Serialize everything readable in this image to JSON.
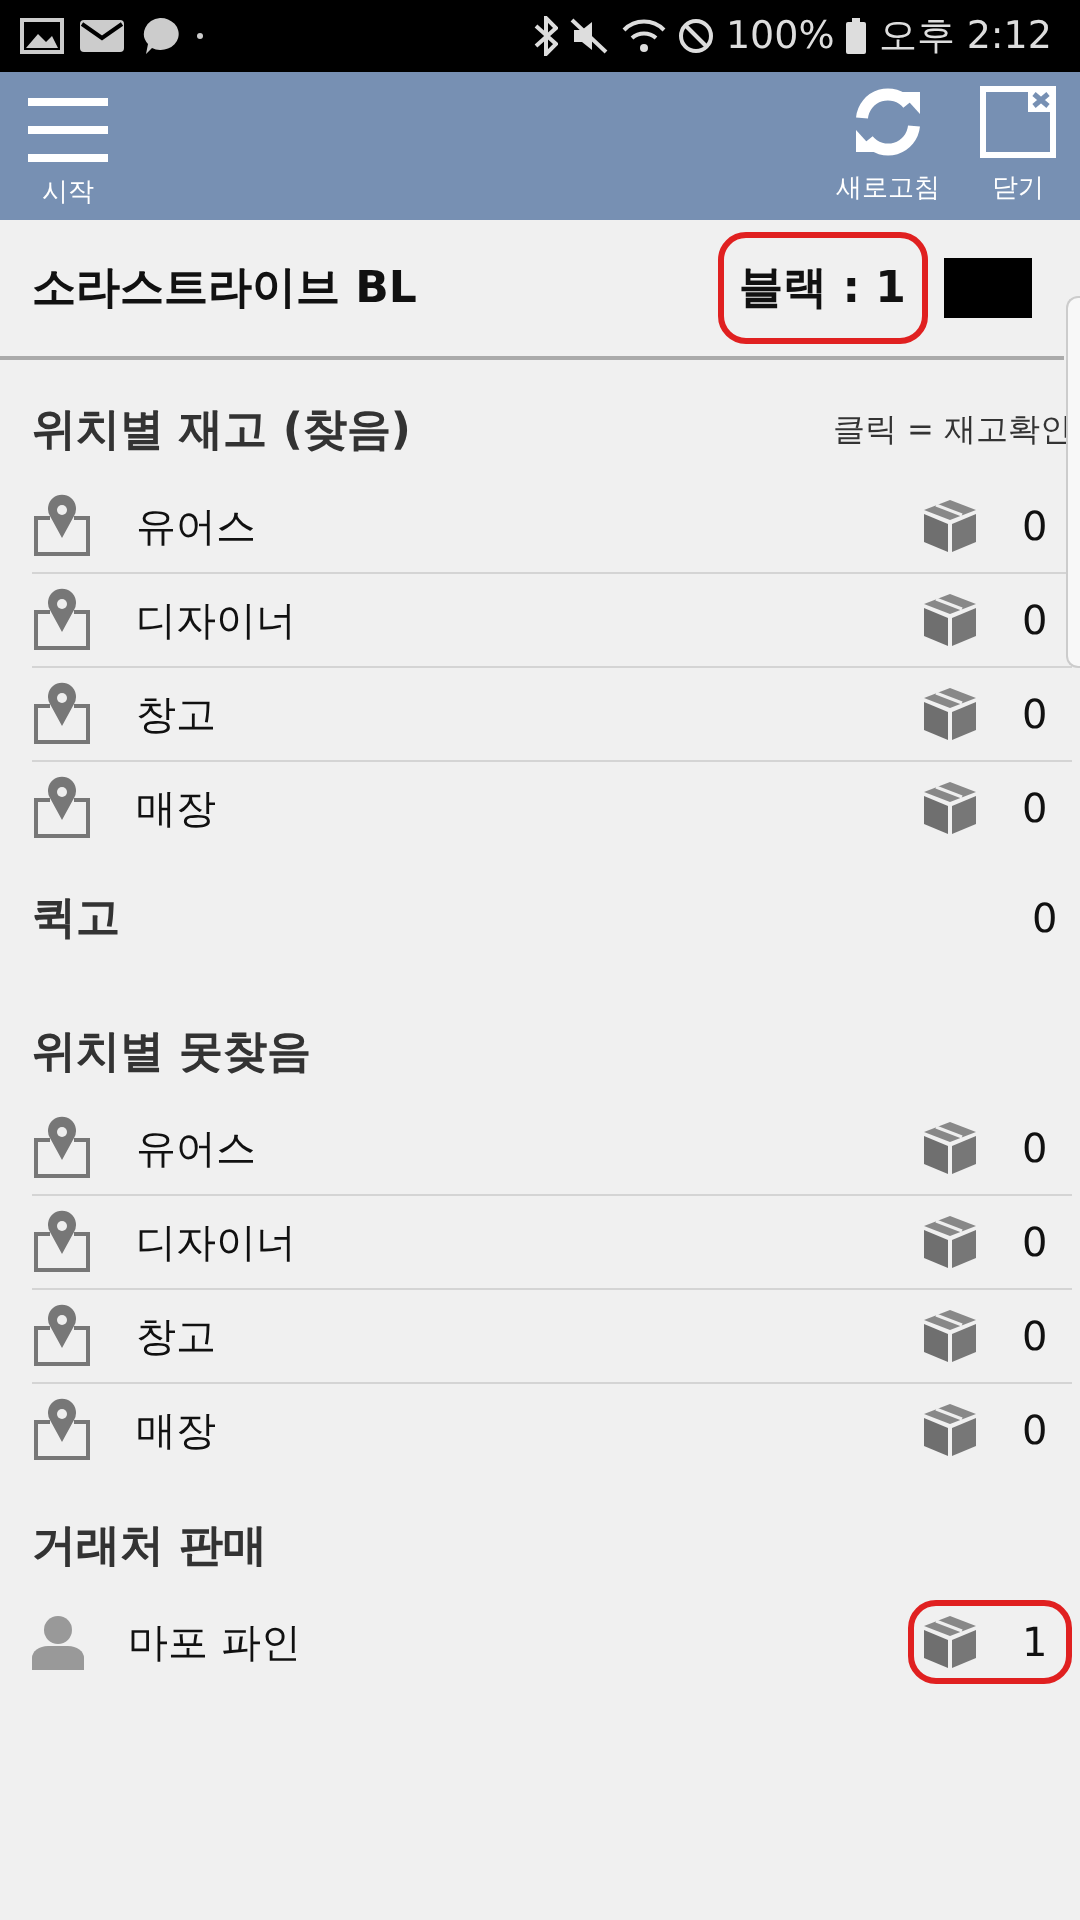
{
  "status_bar": {
    "battery": "100%",
    "time": "오후 2:12"
  },
  "toolbar": {
    "menu_label": "시작",
    "actions": [
      {
        "kind": "refresh",
        "label": "새로고침"
      },
      {
        "kind": "close",
        "label": "닫기"
      }
    ]
  },
  "product": {
    "name": "소라스트라이브 BL",
    "color_label": "블랙 : 1",
    "color": "#000000",
    "highlighted": true
  },
  "sections": [
    {
      "kind": "list",
      "title": "위치별 재고 (찾음)",
      "hint": "클릭 = 재고확인",
      "rows": [
        {
          "name": "유어스",
          "count": "0",
          "highlighted": false
        },
        {
          "name": "디자이너",
          "count": "0",
          "highlighted": false
        },
        {
          "name": "창고",
          "count": "0",
          "highlighted": false
        },
        {
          "name": "매장",
          "count": "0",
          "highlighted": false
        }
      ]
    },
    {
      "kind": "total",
      "title": "퀵고",
      "count": "0"
    },
    {
      "kind": "list",
      "title": "위치별 못찾음",
      "rows": [
        {
          "name": "유어스",
          "count": "0",
          "highlighted": false
        },
        {
          "name": "디자이너",
          "count": "0",
          "highlighted": false
        },
        {
          "name": "창고",
          "count": "0",
          "highlighted": false
        },
        {
          "name": "매장",
          "count": "0",
          "highlighted": false
        }
      ]
    },
    {
      "kind": "list",
      "title": "거래처 판매",
      "rows": [
        {
          "name": "마포 파인",
          "count": "1",
          "highlighted": true
        }
      ]
    }
  ]
}
